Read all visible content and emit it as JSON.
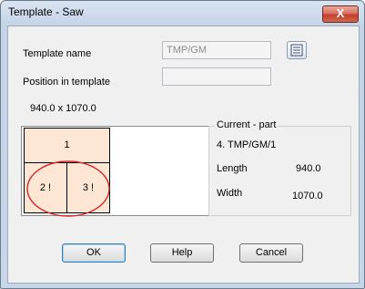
{
  "window": {
    "title": "Template - Saw",
    "close_label": "X"
  },
  "form": {
    "template_name_label": "Template name",
    "template_name_value": "TMP/GM",
    "position_label": "Position in template",
    "position_value": "",
    "dimensions": "940.0 x 1070.0"
  },
  "preview": {
    "chevron": "»",
    "parts": [
      {
        "label": "1"
      },
      {
        "label": "2 !"
      },
      {
        "label": "3 !"
      }
    ]
  },
  "current_part": {
    "group_title": "Current - part",
    "name": "4. TMP/GM/1",
    "length_label": "Length",
    "length_value": "940.0",
    "width_label": "Width",
    "width_value": "1070.0"
  },
  "buttons": {
    "ok": "OK",
    "help": "Help",
    "cancel": "Cancel"
  },
  "colors": {
    "part_fill": "#fde7d4",
    "highlight_ring": "#d9262b"
  }
}
